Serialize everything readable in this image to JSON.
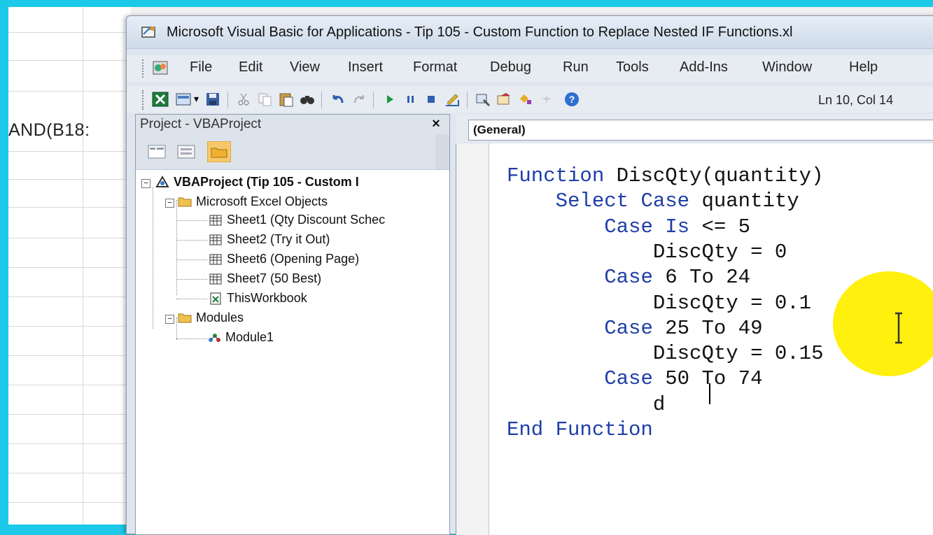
{
  "background_sheet": {
    "formula_fragment": "AND(B18:"
  },
  "window": {
    "title": "Microsoft Visual Basic for Applications - Tip 105 - Custom Function to Replace Nested IF Functions.xl"
  },
  "menu": {
    "items": [
      "File",
      "Edit",
      "View",
      "Insert",
      "Format",
      "Debug",
      "Run",
      "Tools",
      "Add-Ins",
      "Window",
      "Help"
    ]
  },
  "toolbar": {
    "position": "Ln 10, Col 14"
  },
  "project_pane": {
    "title": "Project - VBAProject",
    "close": "×",
    "tree": {
      "root": "VBAProject (Tip 105 - Custom I",
      "excel_objects": "Microsoft Excel Objects",
      "sheets": [
        "Sheet1 (Qty Discount Schec",
        "Sheet2 (Try it Out)",
        "Sheet6 (Opening Page)",
        "Sheet7 (50 Best)",
        "ThisWorkbook"
      ],
      "modules_folder": "Modules",
      "module": "Module1"
    }
  },
  "code_window": {
    "object_combo": "(General)",
    "lines": [
      {
        "indent": "",
        "kw": "Function ",
        "rest": "DiscQty(quantity)"
      },
      {
        "indent": "    ",
        "kw": "Select Case ",
        "rest": "quantity"
      },
      {
        "indent": "        ",
        "kw": "Case Is ",
        "rest": "<= 5"
      },
      {
        "indent": "            ",
        "kw": "",
        "rest": "DiscQty = 0"
      },
      {
        "indent": "        ",
        "kw": "Case ",
        "rest": "6 To 24"
      },
      {
        "indent": "            ",
        "kw": "",
        "rest": "DiscQty = 0.1"
      },
      {
        "indent": "        ",
        "kw": "Case ",
        "rest": "25 To 49"
      },
      {
        "indent": "            ",
        "kw": "",
        "rest": "DiscQty = 0.15"
      },
      {
        "indent": "        ",
        "kw": "Case ",
        "rest": "50 To 74"
      },
      {
        "indent": "            ",
        "kw": "",
        "rest": "d"
      },
      {
        "indent": "",
        "kw": "End Function",
        "rest": ""
      }
    ]
  },
  "colors": {
    "keyword": "#1f3ea8",
    "highlight": "#ffef00",
    "frame": "#1cc9e8"
  }
}
